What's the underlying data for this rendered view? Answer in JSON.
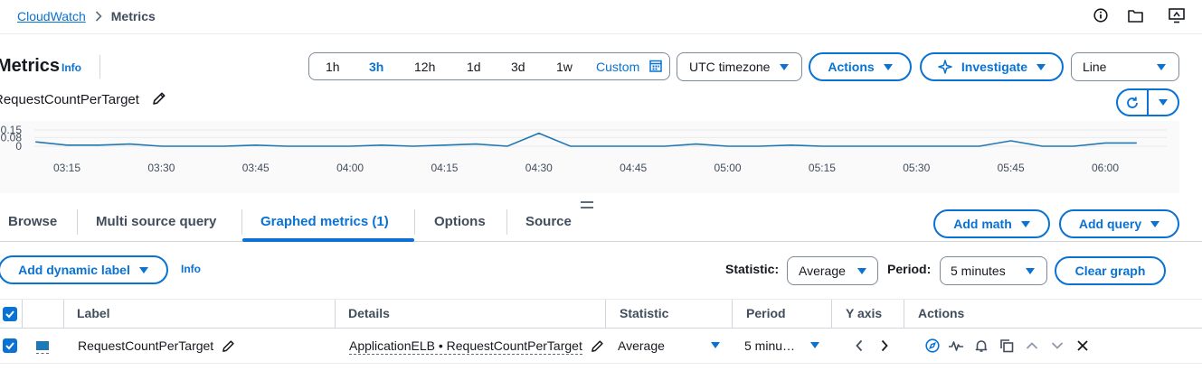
{
  "breadcrumb": {
    "root": "CloudWatch",
    "current": "Metrics"
  },
  "header": {
    "title": "Metrics",
    "info": "Info",
    "graph_name": "RequestCountPerTarget"
  },
  "time_range": {
    "options": [
      "1h",
      "3h",
      "12h",
      "1d",
      "3d",
      "1w",
      "Custom"
    ],
    "selected": "3h"
  },
  "timezone": "UTC timezone",
  "toolbar": {
    "actions": "Actions",
    "investigate": "Investigate",
    "chart_type": "Line"
  },
  "chart_data": {
    "type": "line",
    "y_ticks": [
      "0.15",
      "0.08",
      "0"
    ],
    "x_ticks": [
      "03:15",
      "03:30",
      "03:45",
      "04:00",
      "04:15",
      "04:30",
      "04:45",
      "05:00",
      "05:15",
      "05:30",
      "05:45",
      "06:00"
    ],
    "ylim": [
      0,
      0.15
    ],
    "series": [
      {
        "color": "#1f77b4",
        "points": [
          [
            "03:10",
            0.04
          ],
          [
            "03:15",
            0.01
          ],
          [
            "03:20",
            0.01
          ],
          [
            "03:25",
            0.02
          ],
          [
            "03:30",
            0.0
          ],
          [
            "03:35",
            0.0
          ],
          [
            "03:40",
            0.0
          ],
          [
            "03:45",
            0.01
          ],
          [
            "03:50",
            0.0
          ],
          [
            "03:55",
            0.0
          ],
          [
            "04:00",
            0.0
          ],
          [
            "04:05",
            0.01
          ],
          [
            "04:10",
            0.0
          ],
          [
            "04:15",
            0.01
          ],
          [
            "04:20",
            0.02
          ],
          [
            "04:25",
            0.0
          ],
          [
            "04:30",
            0.12
          ],
          [
            "04:35",
            0.0
          ],
          [
            "04:40",
            0.0
          ],
          [
            "04:45",
            0.0
          ],
          [
            "04:50",
            0.0
          ],
          [
            "04:55",
            0.02
          ],
          [
            "05:00",
            0.0
          ],
          [
            "05:05",
            0.0
          ],
          [
            "05:10",
            0.01
          ],
          [
            "05:15",
            0.0
          ],
          [
            "05:20",
            0.0
          ],
          [
            "05:25",
            0.0
          ],
          [
            "05:30",
            0.0
          ],
          [
            "05:35",
            0.0
          ],
          [
            "05:40",
            0.0
          ],
          [
            "05:45",
            0.05
          ],
          [
            "05:50",
            0.0
          ],
          [
            "05:55",
            0.0
          ],
          [
            "06:00",
            0.03
          ],
          [
            "06:05",
            0.03
          ]
        ]
      }
    ]
  },
  "tabs": [
    "Browse",
    "Multi source query",
    "Graphed metrics (1)",
    "Options",
    "Source"
  ],
  "active_tab": "Graphed metrics (1)",
  "tab_actions": {
    "add_math": "Add math",
    "add_query": "Add query"
  },
  "controls": {
    "add_dynamic_label": "Add dynamic label",
    "info": "Info",
    "statistic_label": "Statistic:",
    "statistic_value": "Average",
    "period_label": "Period:",
    "period_value": "5 minutes",
    "clear_graph": "Clear graph"
  },
  "table": {
    "headers": [
      "Label",
      "Details",
      "Statistic",
      "Period",
      "Y axis",
      "Actions"
    ],
    "rows": [
      {
        "label": "RequestCountPerTarget",
        "details": "ApplicationELB • RequestCountPerTarget",
        "statistic": "Average",
        "period": "5 minu…",
        "color": "#1f77b4"
      }
    ]
  },
  "colors": {
    "accent": "#0972d3",
    "series": "#1f77b4"
  }
}
